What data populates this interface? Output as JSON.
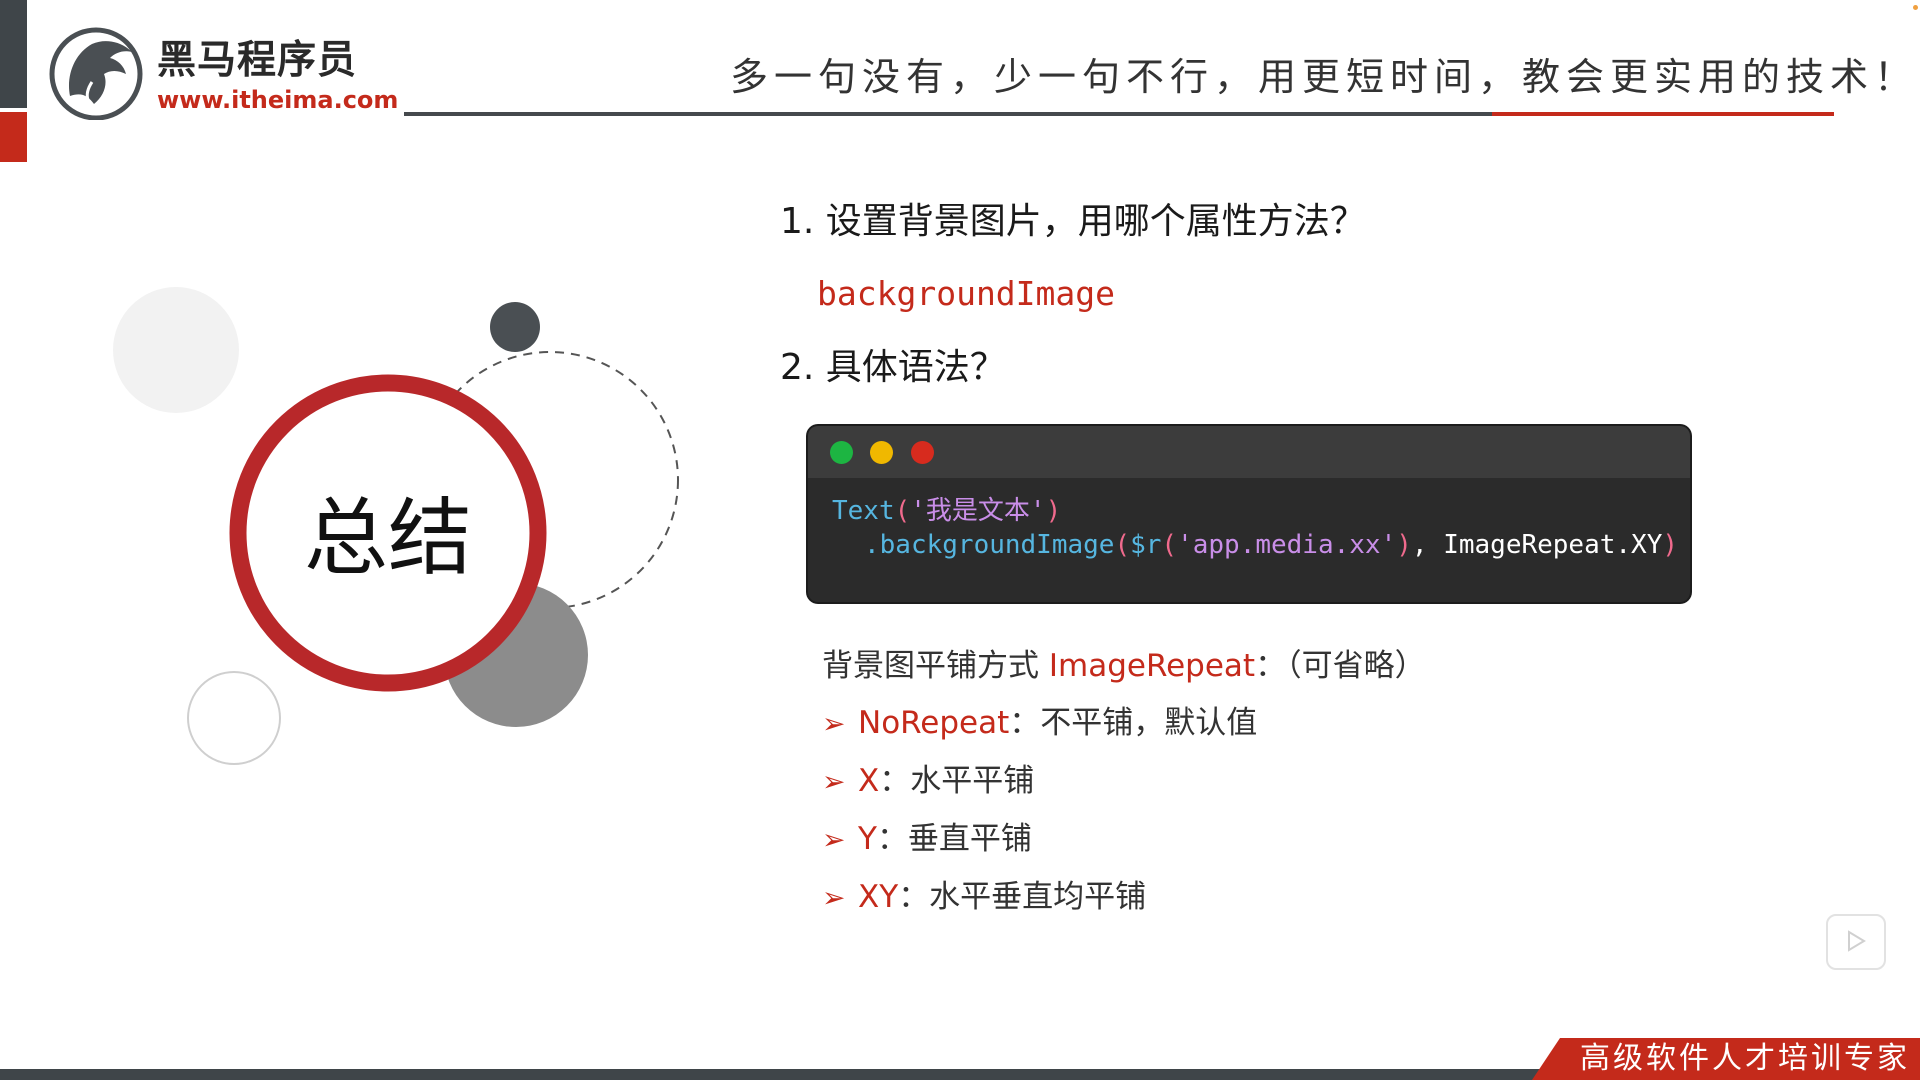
{
  "header": {
    "brand_name": "黑马程序员",
    "brand_url": "www.itheima.com",
    "slogan": "多一句没有，少一句不行，用更短时间，教会更实用的技术！"
  },
  "summary": {
    "title": "总结"
  },
  "questions": [
    {
      "text": "1. 设置背景图片，用哪个属性方法？",
      "answer": "backgroundImage"
    },
    {
      "text": "2. 具体语法？"
    }
  ],
  "code": {
    "line1": {
      "func": "Text",
      "open": "(",
      "str": "'我是文本'",
      "close": ")"
    },
    "line2": {
      "func": ".backgroundImage",
      "open": "(",
      "rfunc": "$r",
      "ropen": "(",
      "str": "'app.media.xx'",
      "rclose": ")",
      "comma": ",",
      "enum": "ImageRepeat.XY",
      "close": ")"
    }
  },
  "repeat": {
    "heading_prefix": "背景图平铺方式 ",
    "heading_keyword": "ImageRepeat",
    "heading_suffix": "：（可省略）",
    "options": [
      {
        "key": "NoRepeat",
        "desc": "：不平铺，默认值"
      },
      {
        "key": "X",
        "desc": "：水平平铺"
      },
      {
        "key": "Y",
        "desc": "：垂直平铺"
      },
      {
        "key": "XY",
        "desc": "：水平垂直均平铺"
      }
    ]
  },
  "footer": {
    "tagline": "高级软件人才培训专家"
  },
  "colors": {
    "accent_red": "#c42a1b",
    "dark_gray": "#3f4549",
    "code_bg": "#2b2b2b"
  },
  "icons": {
    "logo": "horse-head-logo-icon",
    "bullet": "arrow-right-icon",
    "play": "play-icon"
  }
}
